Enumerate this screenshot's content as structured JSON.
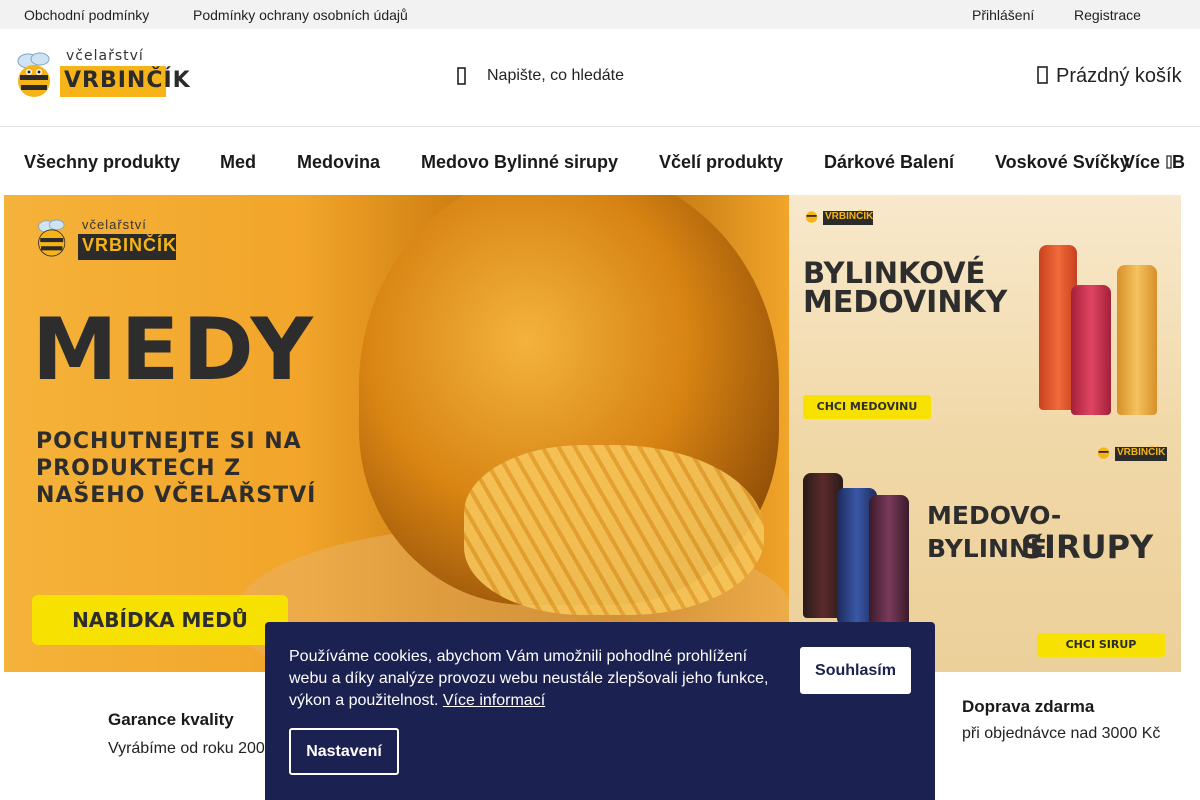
{
  "topbar": {
    "links": [
      "Obchodní podmínky",
      "Podmínky ochrany osobních údajů"
    ],
    "login": "Přihlášení",
    "register": "Registrace"
  },
  "header": {
    "logo_top": "včelařství",
    "logo_bottom": "VRBINČÍK",
    "search_placeholder": "Napište, co hledáte",
    "cart_label": "Prázdný košík"
  },
  "nav": {
    "items": [
      "Všechny produkty",
      "Med",
      "Medovina",
      "Medovo Bylinné sirupy",
      "Včelí produkty",
      "Dárkové Balení",
      "Voskové Svíčky",
      "Více",
      "B"
    ]
  },
  "banners": {
    "main": {
      "logo_top": "včelařství",
      "logo_bottom": "VRBINČÍK",
      "title": "MEDY",
      "subtitle": "POCHUTNEJTE SI NA PRODUKTECH Z NAŠEHO VČELAŘSTVÍ",
      "button": "NABÍDKA MEDŮ"
    },
    "top_right": {
      "logo_bottom": "VRBINČÍK",
      "title_line1": "BYLINKOVÉ",
      "title_line2": "MEDOVINKY",
      "button": "CHCI MEDOVINU"
    },
    "bottom_right": {
      "logo_bottom": "VRBINČÍK",
      "title_line1": "MEDOVO-BYLINNÉ",
      "title_line2": "SIRUPY",
      "button": "CHCI SIRUP"
    }
  },
  "features": {
    "quality_title": "Garance kvality",
    "quality_text": "Vyrábíme od roku 200",
    "shipping_title": "Doprava zdarma",
    "shipping_text": "při objednávce nad 3000 Kč"
  },
  "cookie": {
    "text": "Používáme cookies, abychom Vám umožnili pohodlné prohlížení webu a díky analýze provozu webu neustále zlepšovali jeho funkce, výkon a použitelnost.",
    "more_link": "Více informací",
    "accept": "Souhlasím",
    "settings": "Nastavení"
  },
  "colors": {
    "brand_yellow": "#f6b418",
    "cookie_bg": "#1b2150",
    "topbar_bg": "#f2f2f2"
  },
  "icons": {
    "search": "search-icon",
    "cart": "cart-icon"
  }
}
